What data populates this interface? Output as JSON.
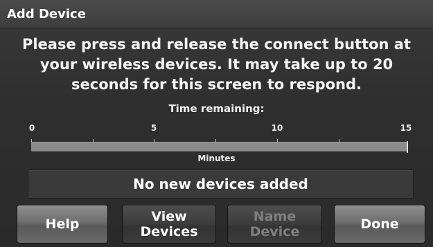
{
  "header": {
    "title": "Add Device"
  },
  "instructions": "Please press and release the connect button at your wireless devices. It may take up to 20 seconds for this screen to respond.",
  "timer": {
    "label": "Time remaining:",
    "ticks": [
      "0",
      "5",
      "10",
      "15"
    ],
    "axis_label": "Minutes",
    "remaining_fraction": 1.0
  },
  "status": "No new devices added",
  "buttons": {
    "help": "Help",
    "view_devices": "View\nDevices",
    "name_device": "Name\nDevice",
    "done": "Done"
  },
  "colors": {
    "screen_bg": "#2f2f2f",
    "text": "#ffffff",
    "disabled_text": "#808080"
  }
}
